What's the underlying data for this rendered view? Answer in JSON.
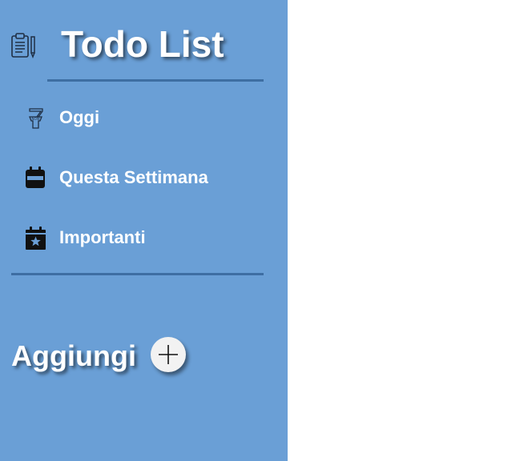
{
  "app": {
    "title": "Todo List"
  },
  "header": {
    "icon": "clipboard-list-icon"
  },
  "nav": {
    "items": [
      {
        "label": "Oggi",
        "icon": "today-calendar-icon"
      },
      {
        "label": "Questa Settimana",
        "icon": "week-calendar-icon"
      },
      {
        "label": "Importanti",
        "icon": "star-calendar-icon"
      }
    ]
  },
  "add": {
    "label": "Aggiungi",
    "icon": "plus-icon"
  },
  "colors": {
    "sidebar": "#6a9fd6",
    "divider": "#3e6ea3",
    "text": "#ffffff",
    "icon": "#111111",
    "content": "#ffffff"
  }
}
